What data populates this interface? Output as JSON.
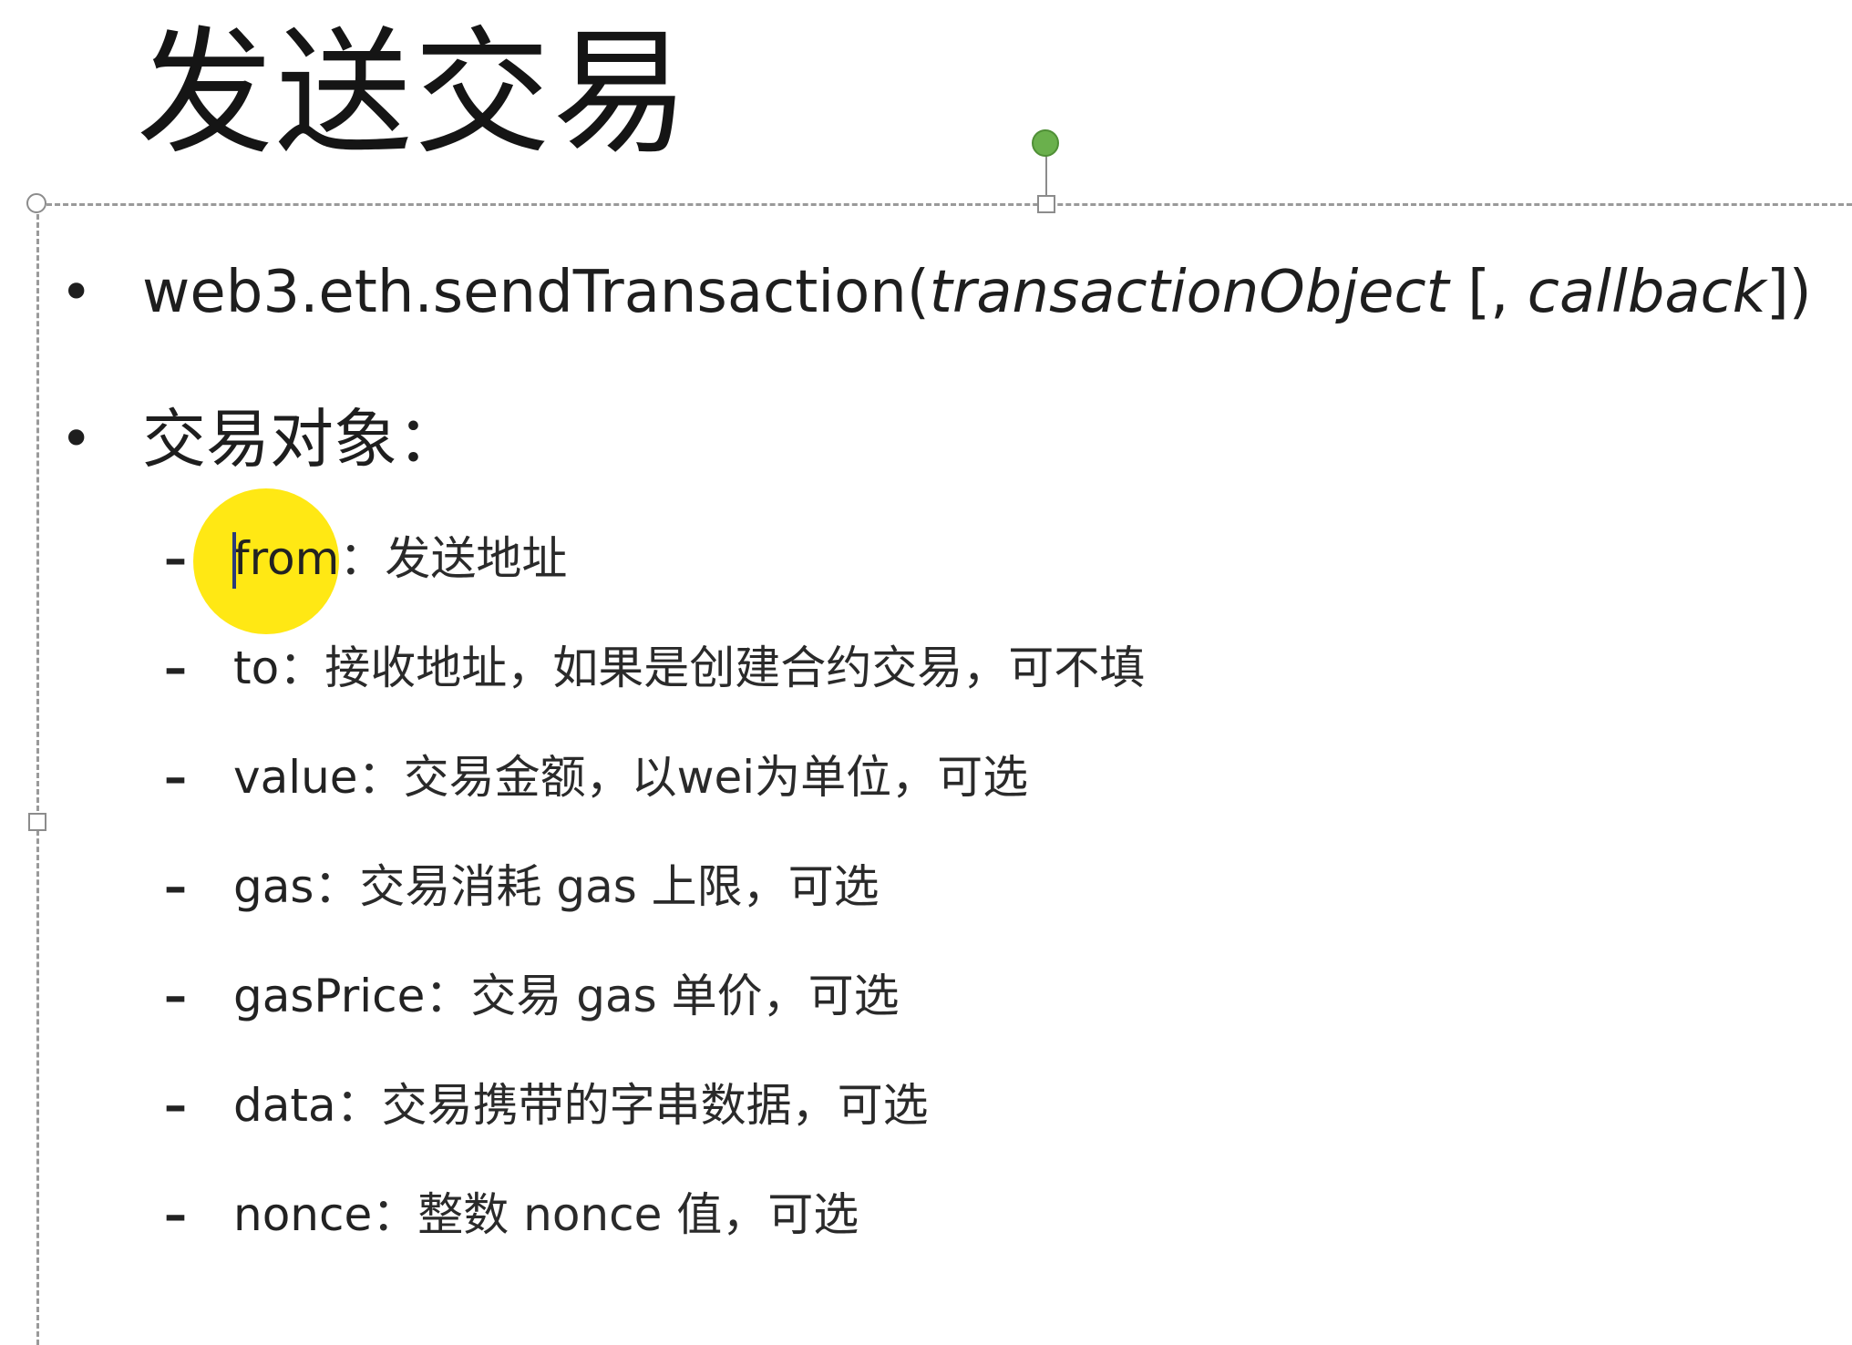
{
  "slide": {
    "title": "发送交易",
    "bullets": [
      {
        "prefix": "web3.eth.sendTransaction(",
        "arg1": "transactionObject",
        "sep": " [, ",
        "arg2": "callback",
        "suffix": "])"
      },
      {
        "label": "交易对象："
      }
    ],
    "fields": [
      {
        "key": "from",
        "desc": "：发送地址"
      },
      {
        "key": "to",
        "desc": "：接收地址，如果是创建合约交易，可不填"
      },
      {
        "key": "value",
        "desc": "：交易金额，以wei为单位，可选"
      },
      {
        "key": "gas",
        "desc": "：交易消耗 gas 上限，可选"
      },
      {
        "key": "gasPrice",
        "desc": "：交易 gas 单价，可选"
      },
      {
        "key": "data",
        "desc": "：交易携带的字串数据，可选"
      },
      {
        "key": "nonce",
        "desc": "：整数 nonce 值，可选"
      }
    ],
    "bullet_symbol": "•",
    "dash_symbol": "–"
  },
  "colors": {
    "highlight": "#ffe600",
    "rotate_handle": "#6ab04c",
    "frame": "#9a9a9a"
  },
  "icons": [
    "rotate-handle-icon",
    "resize-handle-icon",
    "mouse-highlight-icon",
    "text-caret-icon"
  ]
}
